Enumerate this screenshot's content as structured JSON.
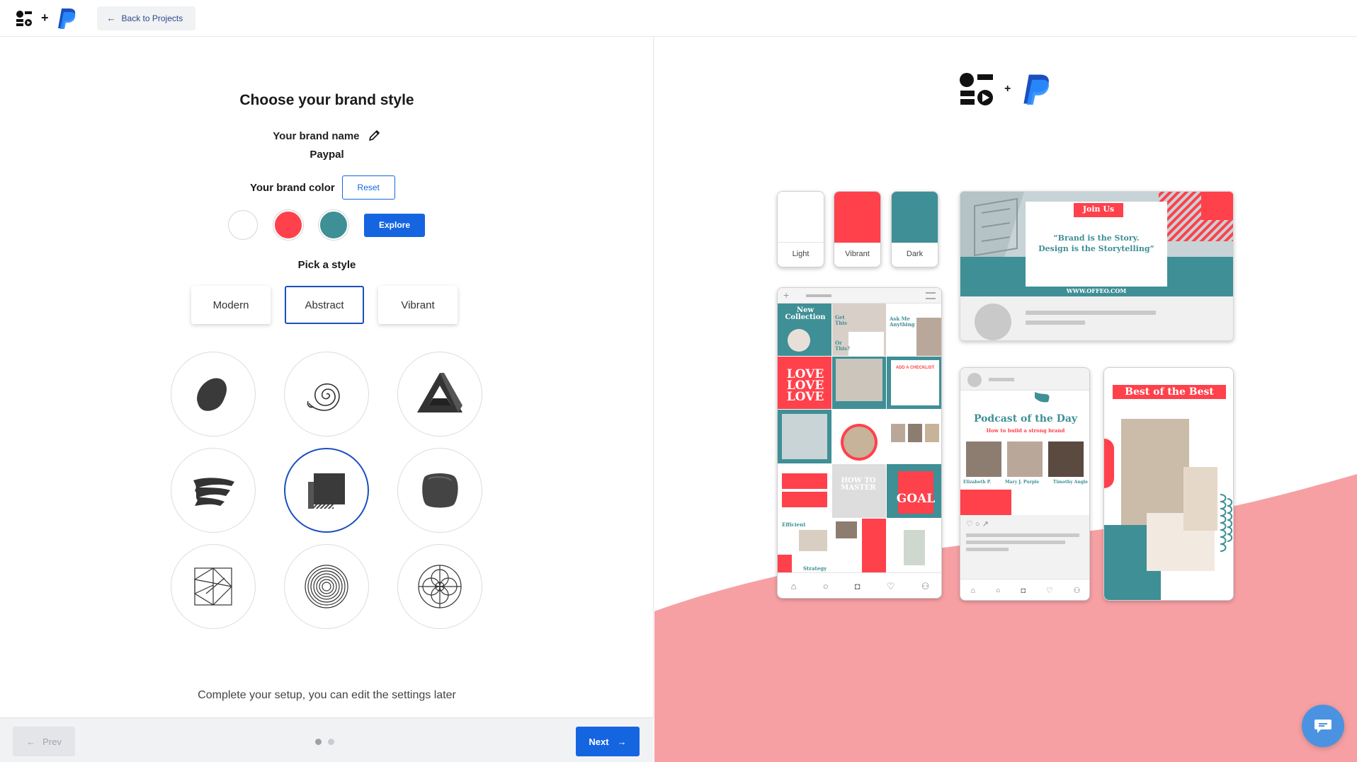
{
  "topbar": {
    "back_label": "Back to Projects",
    "plus": "+"
  },
  "setup": {
    "title": "Choose your brand style",
    "brand_name_label": "Your brand name",
    "brand_name_value": "Paypal",
    "brand_color_label": "Your brand color",
    "reset_label": "Reset",
    "explore_label": "Explore",
    "swatch_colors": [
      "#ffffff",
      "#ff414c",
      "#3f8f96"
    ],
    "pick_label": "Pick a style",
    "style_tabs": [
      "Modern",
      "Abstract",
      "Vibrant"
    ],
    "active_tab": "Abstract",
    "style_options": [
      "blob",
      "spiral",
      "impossible-triangle",
      "brush-stroke",
      "layered-squares",
      "rounded-square",
      "geometric-lines",
      "concentric-circles",
      "mandala"
    ],
    "active_option": "layered-squares",
    "footer_note": "Complete your setup, you can edit the settings later",
    "prev_label": "Prev",
    "next_label": "Next",
    "progress_dots": 2,
    "active_dot": 0
  },
  "preview": {
    "plus": "+",
    "swatches": [
      {
        "label": "Light",
        "color": "#ffffff"
      },
      {
        "label": "Vibrant",
        "color": "#ff414c"
      },
      {
        "label": "Dark",
        "color": "#3f8f96"
      }
    ],
    "post": {
      "badge": "Join Us",
      "quote_line1": "“Brand is the Story.",
      "quote_line2": "Design is the Storytelling”",
      "url": "WWW.OFFEO.COM"
    },
    "grid_tiles": {
      "new_collection": "New Collection",
      "get_this": "Get This",
      "or_this": "Or This?",
      "ask_me": "Ask Me Anything",
      "love": "LOVE LOVE LOVE",
      "add_checklist": "ADD A CHECKLIST",
      "goal": "GOAL",
      "efficient": "Efficient",
      "strategy": "Strategy",
      "how_to_master": "HOW TO MASTER"
    },
    "podcast": {
      "title": "Podcast of the Day",
      "subtitle": "How to build a strong brand",
      "people": [
        "Elizabeth P.",
        "Mary J. Purple",
        "Timothy Angle"
      ]
    },
    "story": {
      "title": "Best of the Best"
    },
    "accent_red": "#ff414c",
    "accent_teal": "#3f8f96",
    "wave_color": "#f7a0a4"
  }
}
